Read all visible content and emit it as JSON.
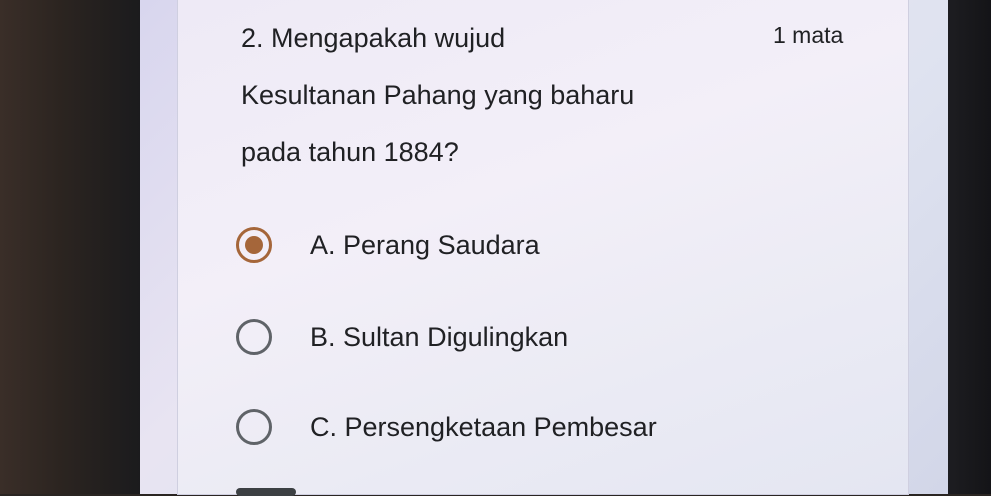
{
  "question": {
    "number_text": "2. Mengapakah wujud",
    "line2": "Kesultanan Pahang yang baharu",
    "line3": "pada tahun 1884?",
    "points": "1 mata"
  },
  "options": [
    {
      "label": "A. Perang Saudara",
      "selected": true
    },
    {
      "label": "B. Sultan Digulingkan",
      "selected": false
    },
    {
      "label": "C. Persengketaan Pembesar",
      "selected": false
    }
  ],
  "colors": {
    "accent": "#a5663a",
    "radio_border": "#5f6368",
    "text": "#202124"
  }
}
